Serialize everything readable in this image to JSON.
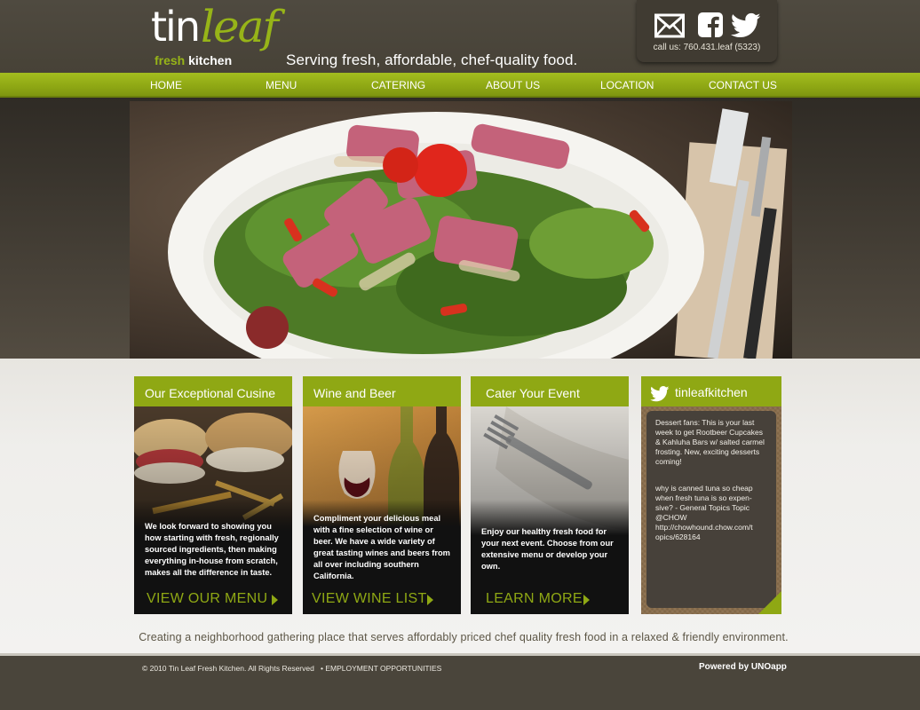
{
  "logo": {
    "tin": "tin",
    "leaf": "leaf",
    "fresh": "fresh",
    "kitchen": "kitchen"
  },
  "tagline": "Serving fresh, affordable, chef-quality food.",
  "social": {
    "icons": [
      "mail-icon",
      "facebook-icon",
      "twitter-icon"
    ],
    "call_us": "call us: 760.431.leaf (5323)"
  },
  "nav": {
    "items": [
      {
        "label": "HOME"
      },
      {
        "label": "MENU"
      },
      {
        "label": "CATERING"
      },
      {
        "label": "ABOUT US"
      },
      {
        "label": "LOCATION"
      },
      {
        "label": "CONTACT US"
      }
    ]
  },
  "panels": [
    {
      "title": "Our Exceptional Cusine",
      "text": "We look forward to showing you how starting with fresh, regionally sourced ingredients, then making everything in-house from scratch, makes all the difference in taste.",
      "link": "VIEW OUR MENU"
    },
    {
      "title": "Wine and Beer",
      "text": "Compliment your delicious meal with a fine selection of wine or beer.  We have a wide variety of great tasting wines and beers from all over including southern California.",
      "link": "VIEW WINE LIST"
    },
    {
      "title": "Cater Your Event",
      "text": "Enjoy our healthy fresh food for your next event.  Choose from our extensive menu or develop your own.",
      "link": "LEARN MORE"
    }
  ],
  "twitter": {
    "handle": "tinleafkitchen",
    "tweets": [
      "Dessert fans: This is your last  week to get Rootbeer Cupcakes & Kahluha Bars w/ salted carmel frosting. New, exciting desserts coming!",
      "why is canned tuna so cheap when fresh tuna is so expen- sive? - General Topics Topic @CHOW http://chowhound.chow.com/t opics/628164"
    ]
  },
  "mission": "Creating a neighborhood gathering place that serves affordably priced chef quality fresh food in a relaxed & friendly environment.",
  "footer": {
    "copyright": "© 2010 Tin Leaf Fresh Kitchen. All Rights Reserved",
    "employment": "• EMPLOYMENT OPPORTUNITIES",
    "powered": "Powered by UNOapp"
  },
  "colors": {
    "brand_green": "#8fa814",
    "header_brown": "#4a453b"
  }
}
